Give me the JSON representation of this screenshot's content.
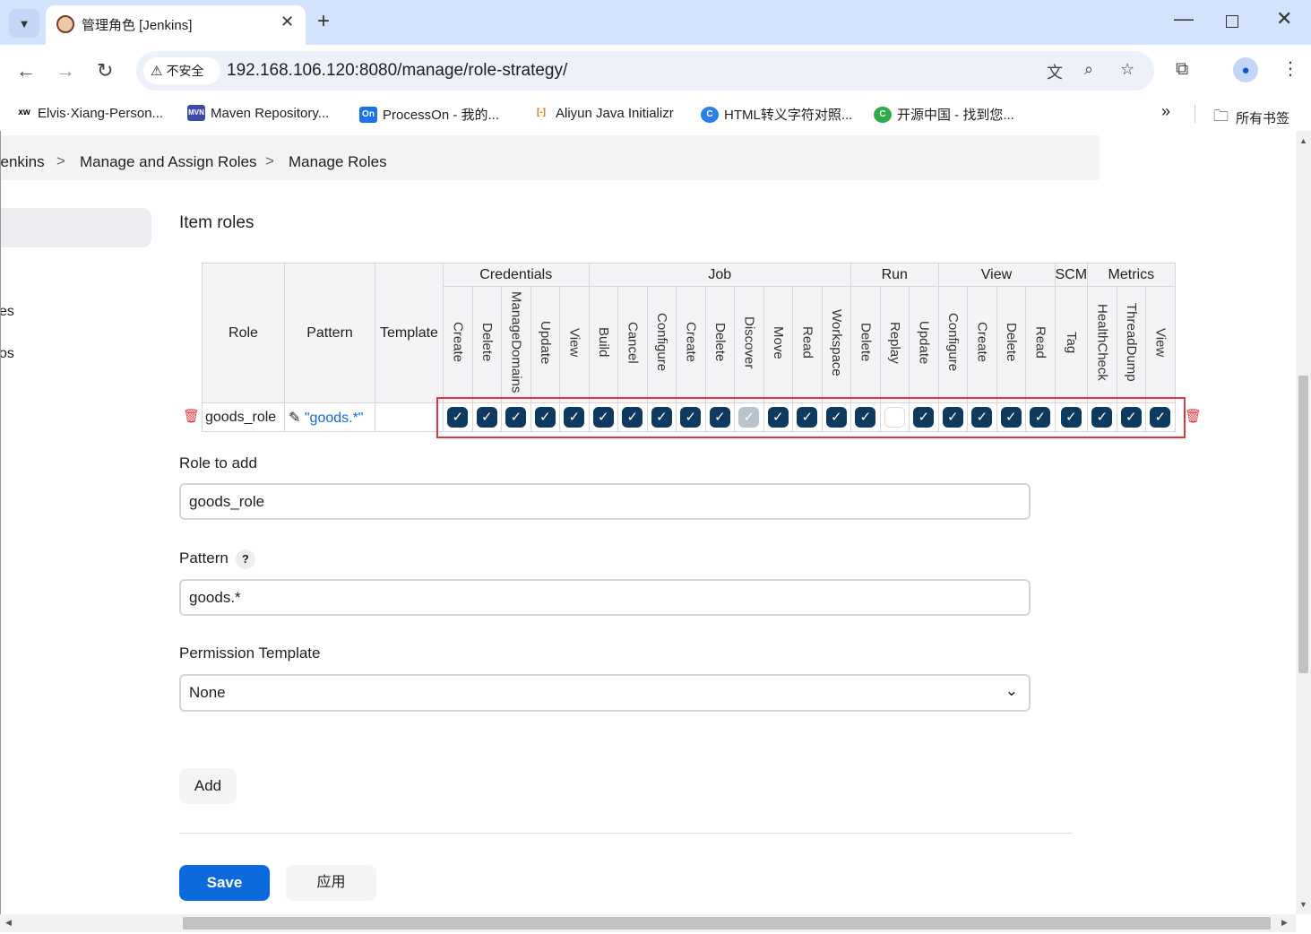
{
  "browser": {
    "tab_title": "管理角色 [Jenkins]",
    "tab_close": "✕",
    "new_tab": "+",
    "insecure_label": "不安全",
    "url": "192.168.106.120:8080/manage/role-strategy/",
    "bookmarks": [
      {
        "label": "Elvis·Xiang-Person...",
        "icon": "xw"
      },
      {
        "label": "Maven Repository...",
        "icon": "MVN"
      },
      {
        "label": "ProcessOn - 我的...",
        "icon": "On"
      },
      {
        "label": "Aliyun Java Initializr",
        "icon": "[-]"
      },
      {
        "label": "HTML转义字符对照...",
        "icon": "C"
      },
      {
        "label": "开源中国 - 找到您...",
        "icon": "C"
      }
    ],
    "bookmarks_more": "»",
    "all_bookmarks": "所有书签"
  },
  "breadcrumb": {
    "items": [
      "Jenkins",
      "Manage and Assign Roles",
      "Manage Roles"
    ],
    "separator": ">"
  },
  "sidebar": {
    "frag1": "es",
    "frag2": "os"
  },
  "item_roles": {
    "title": "Item roles",
    "headers": {
      "role": "Role",
      "pattern": "Pattern",
      "template": "Template"
    },
    "groups": [
      {
        "name": "Credentials",
        "permissions": [
          "Create",
          "Delete",
          "ManageDomains",
          "Update",
          "View"
        ]
      },
      {
        "name": "Job",
        "permissions": [
          "Build",
          "Cancel",
          "Configure",
          "Create",
          "Delete",
          "Discover",
          "Move",
          "Read",
          "Workspace"
        ]
      },
      {
        "name": "Run",
        "permissions": [
          "Delete",
          "Replay",
          "Update"
        ]
      },
      {
        "name": "View",
        "permissions": [
          "Configure",
          "Create",
          "Delete",
          "Read"
        ]
      },
      {
        "name": "SCM",
        "permissions": [
          "Tag"
        ]
      },
      {
        "name": "Metrics",
        "permissions": [
          "HealthCheck",
          "ThreadDump",
          "View"
        ]
      }
    ],
    "rows": [
      {
        "role": "goods_role",
        "pattern": "\"goods.*\"",
        "template": "",
        "states": [
          "on",
          "on",
          "on",
          "on",
          "on",
          "on",
          "on",
          "on",
          "on",
          "on",
          "disabled",
          "on",
          "on",
          "on",
          "on",
          "off",
          "on",
          "on",
          "on",
          "on",
          "on",
          "on",
          "on",
          "on",
          "on"
        ]
      }
    ]
  },
  "form": {
    "role_label": "Role to add",
    "role_value": "goods_role",
    "pattern_label": "Pattern",
    "pattern_help": "?",
    "pattern_value": "goods.*",
    "template_label": "Permission Template",
    "template_value": "None"
  },
  "buttons": {
    "add": "Add",
    "save": "Save",
    "apply": "应用"
  },
  "colors": {
    "checkbox": "#0f3a5f",
    "save": "#0b6bde",
    "highlight": "#e0383e"
  }
}
